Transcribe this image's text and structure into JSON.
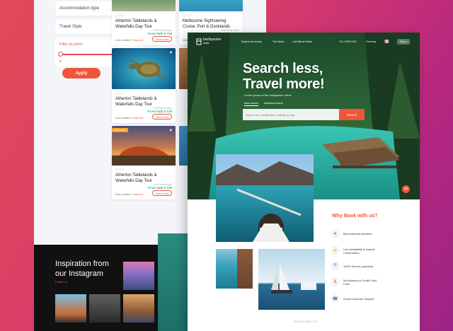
{
  "filters": {
    "accommodation_type": "Accommodation type",
    "travel_style": "Travel Style",
    "price_title": "Filter by price",
    "price_min": "0",
    "price_max": "1000+",
    "apply": "Apply"
  },
  "cards": [
    {
      "title": "Atherton Tablelands & Waterfalls Day Tour",
      "from": "Full Ready Apply",
      "price": "From NZD $ 139",
      "avail": "Next available: ",
      "avail_date": "Tomorrow",
      "btn": "View more"
    },
    {
      "title": "Melbourne Sightseeing Cruise: Port & Docklands",
      "from": "Full Ready Apply",
      "price": "From NZD $ 139",
      "avail": "Next available: ",
      "avail_date": "Tomorrow",
      "btn": "View more"
    },
    {
      "title": "Atherton Tablelands & Waterfalls Day Tour",
      "from": "Full Ready Apply",
      "price": "From NZD $ 139",
      "avail": "Next available: ",
      "avail_date": "Tomorrow",
      "btn": "View more"
    },
    {
      "title": "Atherton Tablelands & Waterfalls Day Tour",
      "from": "Full Ready Apply",
      "price": "From NZD $ 139",
      "avail": "Next available: ",
      "avail_date": "Tomorrow",
      "btn": "View more",
      "badge": "POPULAR"
    }
  ],
  "instagram": {
    "title_line1": "Inspiration from",
    "title_line2": "our Instagram",
    "link": "Follow us"
  },
  "front": {
    "logo_line1": "backpacker",
    "logo_line2": "deals",
    "nav": [
      "Explore by country",
      "Trip Styles",
      "Last Minute Deals"
    ],
    "phone": "+61 2 8000 000",
    "currency": "Currency",
    "signin": "Sign in",
    "hero_title_line1": "Search less,",
    "hero_title_line2": "Travel more!",
    "hero_sub": "Lorem ipsum of the backpacker offers",
    "tabs": [
      "Basic search",
      "Advanced search"
    ],
    "search_placeholder": "Search for a destination, activity or tour",
    "search_btn": "Search",
    "why_title": "Why Book with us?",
    "why_items": [
      "Best selected activities",
      "Live Availability & Instant Confirmation",
      "100% Secure payments",
      "No Booking or Credit Card Fees",
      "Great Customer Support"
    ],
    "selling": "SELLING BEST OF"
  }
}
